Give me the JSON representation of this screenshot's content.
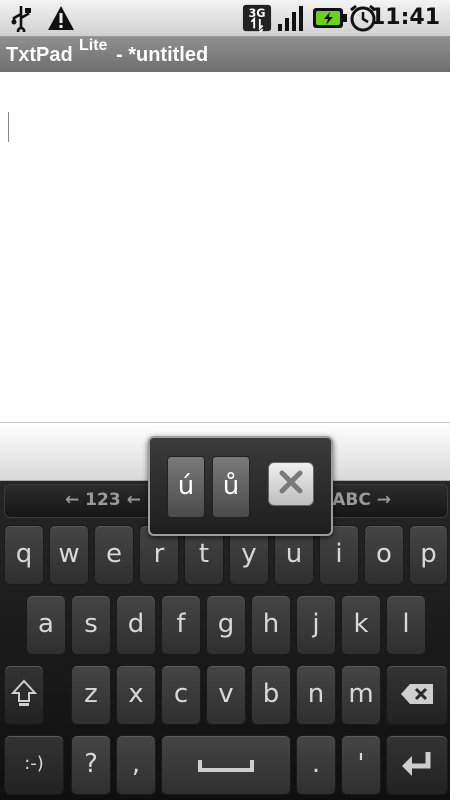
{
  "status_bar": {
    "icons": [
      "usb-icon",
      "warning-icon",
      "3g-icon",
      "signal-icon",
      "battery-charging-icon",
      "alarm-icon"
    ],
    "network_label": "3G",
    "time": "11:41"
  },
  "title_bar": {
    "app_name": "TxtPad",
    "app_edition": "Lite",
    "doc_title": "- *untitled"
  },
  "editor": {
    "content": ""
  },
  "keyboard": {
    "lang_left": "← 123 ←",
    "lang_right": "ABC →",
    "row1": [
      "q",
      "w",
      "e",
      "r",
      "t",
      "y",
      "u",
      "i",
      "o",
      "p"
    ],
    "row2": [
      "a",
      "s",
      "d",
      "f",
      "g",
      "h",
      "j",
      "k",
      "l"
    ],
    "row3": [
      "z",
      "x",
      "c",
      "v",
      "b",
      "n",
      "m"
    ],
    "row4": {
      "emoticon": ":-)",
      "question": "?",
      "comma": ",",
      "period": ".",
      "apostrophe": "'"
    }
  },
  "accent_popup": {
    "options": [
      "ú",
      "ů"
    ]
  }
}
